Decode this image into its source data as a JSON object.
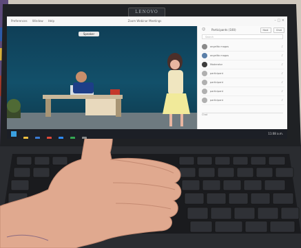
{
  "photo": {
    "subject": "thumbs up in front of laptop showing video meeting",
    "laptop_brand_plate": "LENOVO"
  },
  "meeting_app": {
    "menu_items": [
      "Preferences",
      "Window",
      "Help"
    ],
    "window_title": "Zoom Webinar Meetings",
    "speaking_indicator": "Speaker",
    "panel_title": "Participants (100)",
    "panel_buttons": [
      "Host",
      "Chat"
    ],
    "search_placeholder": "Search",
    "participants": [
      {
        "name": "angelito magos"
      },
      {
        "name": "angelito magos"
      },
      {
        "name": "Moderator"
      },
      {
        "name": "participant"
      },
      {
        "name": "participant"
      },
      {
        "name": "participant"
      },
      {
        "name": "participant"
      }
    ],
    "chat_label": "Chat"
  },
  "taskbar": {
    "clock": "11:08 a.m."
  }
}
